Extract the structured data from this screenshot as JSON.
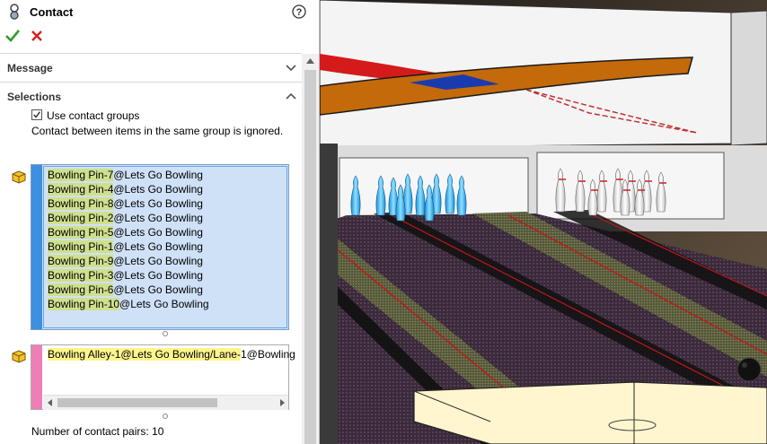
{
  "panel": {
    "title": "Contact",
    "icons": {
      "title": "contact-mate-icon",
      "help": "help-icon",
      "ok": "checkmark-icon",
      "cancel": "close-icon"
    },
    "sections": {
      "message": "Message",
      "selections": "Selections"
    },
    "use_contact_groups": {
      "label": "Use contact groups",
      "checked": true
    },
    "info_text": "Contact between items in the same group is ignored.",
    "group1": {
      "color": "#3d8fe0",
      "items": [
        {
          "hl": "Bowling Pin-7",
          "rest": "@Lets Go Bowling"
        },
        {
          "hl": "Bowling Pin-4",
          "rest": "@Lets Go Bowling"
        },
        {
          "hl": "Bowling Pin-8",
          "rest": "@Lets Go Bowling"
        },
        {
          "hl": "Bowling Pin-2",
          "rest": "@Lets Go Bowling"
        },
        {
          "hl": "Bowling Pin-5",
          "rest": "@Lets Go Bowling"
        },
        {
          "hl": "Bowling Pin-1",
          "rest": "@Lets Go Bowling"
        },
        {
          "hl": "Bowling Pin-9",
          "rest": "@Lets Go Bowling"
        },
        {
          "hl": "Bowling Pin-3",
          "rest": "@Lets Go Bowling"
        },
        {
          "hl": "Bowling Pin-6",
          "rest": "@Lets Go Bowling"
        },
        {
          "hl": "Bowling Pin-10",
          "rest": "@Lets Go Bowling"
        }
      ]
    },
    "group2": {
      "color": "#ee7fb6",
      "items": [
        {
          "hl": "Bowling Alley-1@Lets Go Bowling/Lane-",
          "rest": "1@Bowling"
        }
      ]
    },
    "pairs_text": "Number of contact pairs: 10"
  }
}
